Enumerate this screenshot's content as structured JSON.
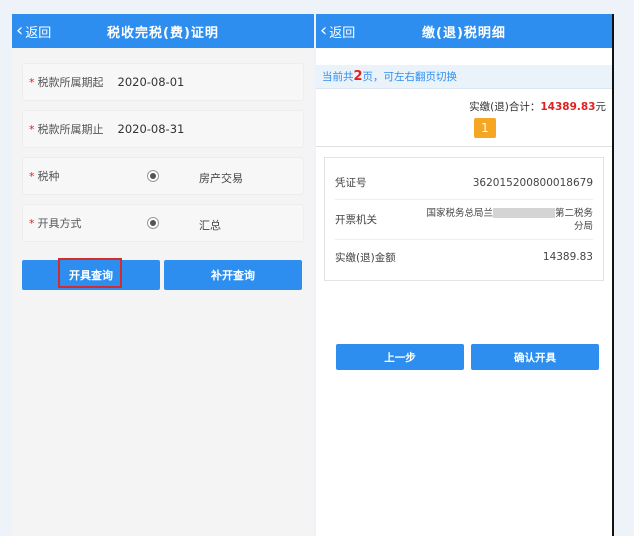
{
  "left": {
    "header": {
      "back_label": "返回",
      "title": "税收完税(费)证明"
    },
    "fields": [
      {
        "label": "税款所属期起",
        "value": "2020-08-01",
        "required_mark": "*"
      },
      {
        "label": "税款所属期止",
        "value": "2020-08-31",
        "required_mark": "*"
      },
      {
        "label": "税种",
        "option": "房产交易",
        "required_mark": "*"
      },
      {
        "label": "开具方式",
        "option": "汇总",
        "required_mark": "*"
      }
    ],
    "buttons": {
      "query": "开具查询",
      "reissue": "补开查询"
    }
  },
  "right": {
    "header": {
      "back_label": "返回",
      "title": "缴(退)税明细"
    },
    "notice": {
      "prefix": "当前共",
      "count": "2",
      "suffix": "页，可左右翻页切换"
    },
    "total": {
      "label": "实缴(退)合计：",
      "amount": "14389.83",
      "unit": "元"
    },
    "page_indicator": "1",
    "details": {
      "voucher_label": "凭证号",
      "voucher_value": "362015200800018679",
      "org_label": "开票机关",
      "org_value_a": "国家税务总局兰",
      "org_value_b": "第二税务",
      "org_value_c": "分局",
      "amount_label": "实缴(退)金额",
      "amount_value": "14389.83"
    },
    "buttons": {
      "prev": "上一步",
      "confirm": "确认开具"
    }
  },
  "colors": {
    "primary": "#2d8ef0",
    "accent_red": "#e02020",
    "page_badge": "#f5a623",
    "highlight_border": "#d42b2b"
  }
}
